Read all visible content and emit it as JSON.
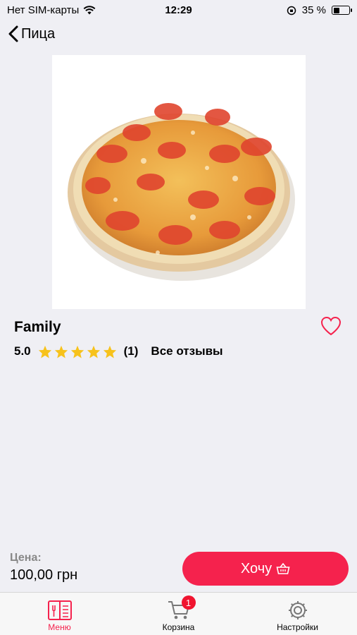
{
  "status": {
    "carrier": "Нет SIM-карты",
    "time": "12:29",
    "battery": "35 %",
    "battery_level": 0.35
  },
  "nav": {
    "back_title": "Пица"
  },
  "product": {
    "name": "Family",
    "rating": "5.0",
    "stars": 5,
    "review_count": "(1)",
    "reviews_link": "Все отзывы",
    "image": "pizza-photo"
  },
  "price": {
    "label": "Цена:",
    "value": "100,00 грн"
  },
  "cta": {
    "label": "Хочу",
    "icon": "basket-icon"
  },
  "tabs": [
    {
      "label": "Меню",
      "icon": "menu-book-icon",
      "active": true
    },
    {
      "label": "Корзина",
      "icon": "cart-icon",
      "badge": "1"
    },
    {
      "label": "Настройки",
      "icon": "gear-icon"
    }
  ],
  "colors": {
    "accent": "#f5224d",
    "star": "#f7c21b",
    "background": "#efeff4"
  }
}
